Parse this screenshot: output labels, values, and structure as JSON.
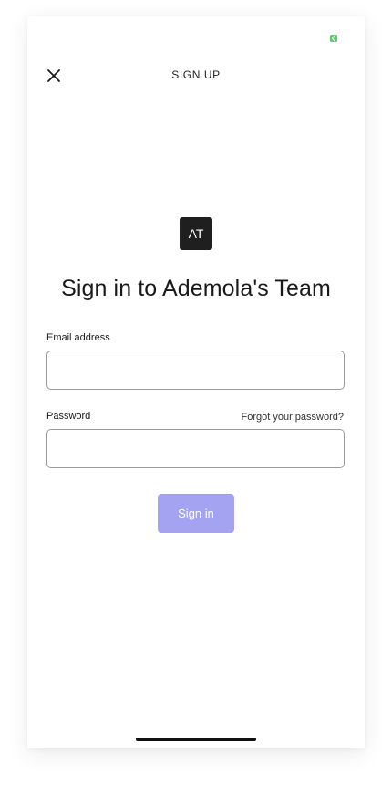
{
  "header": {
    "title": "SIGN UP",
    "close_icon": "close-icon"
  },
  "status_bar": {
    "battery_icon": "battery-icon",
    "battery_color": "#5cc96b"
  },
  "team": {
    "initials": "AT",
    "headline": "Sign in to Ademola's Team"
  },
  "form": {
    "email_label": "Email address",
    "email_value": "",
    "email_placeholder": "",
    "password_label": "Password",
    "password_value": "",
    "password_placeholder": "",
    "forgot_link": "Forgot your password?",
    "submit_label": "Sign in",
    "submit_color": "#a3a3f2"
  }
}
